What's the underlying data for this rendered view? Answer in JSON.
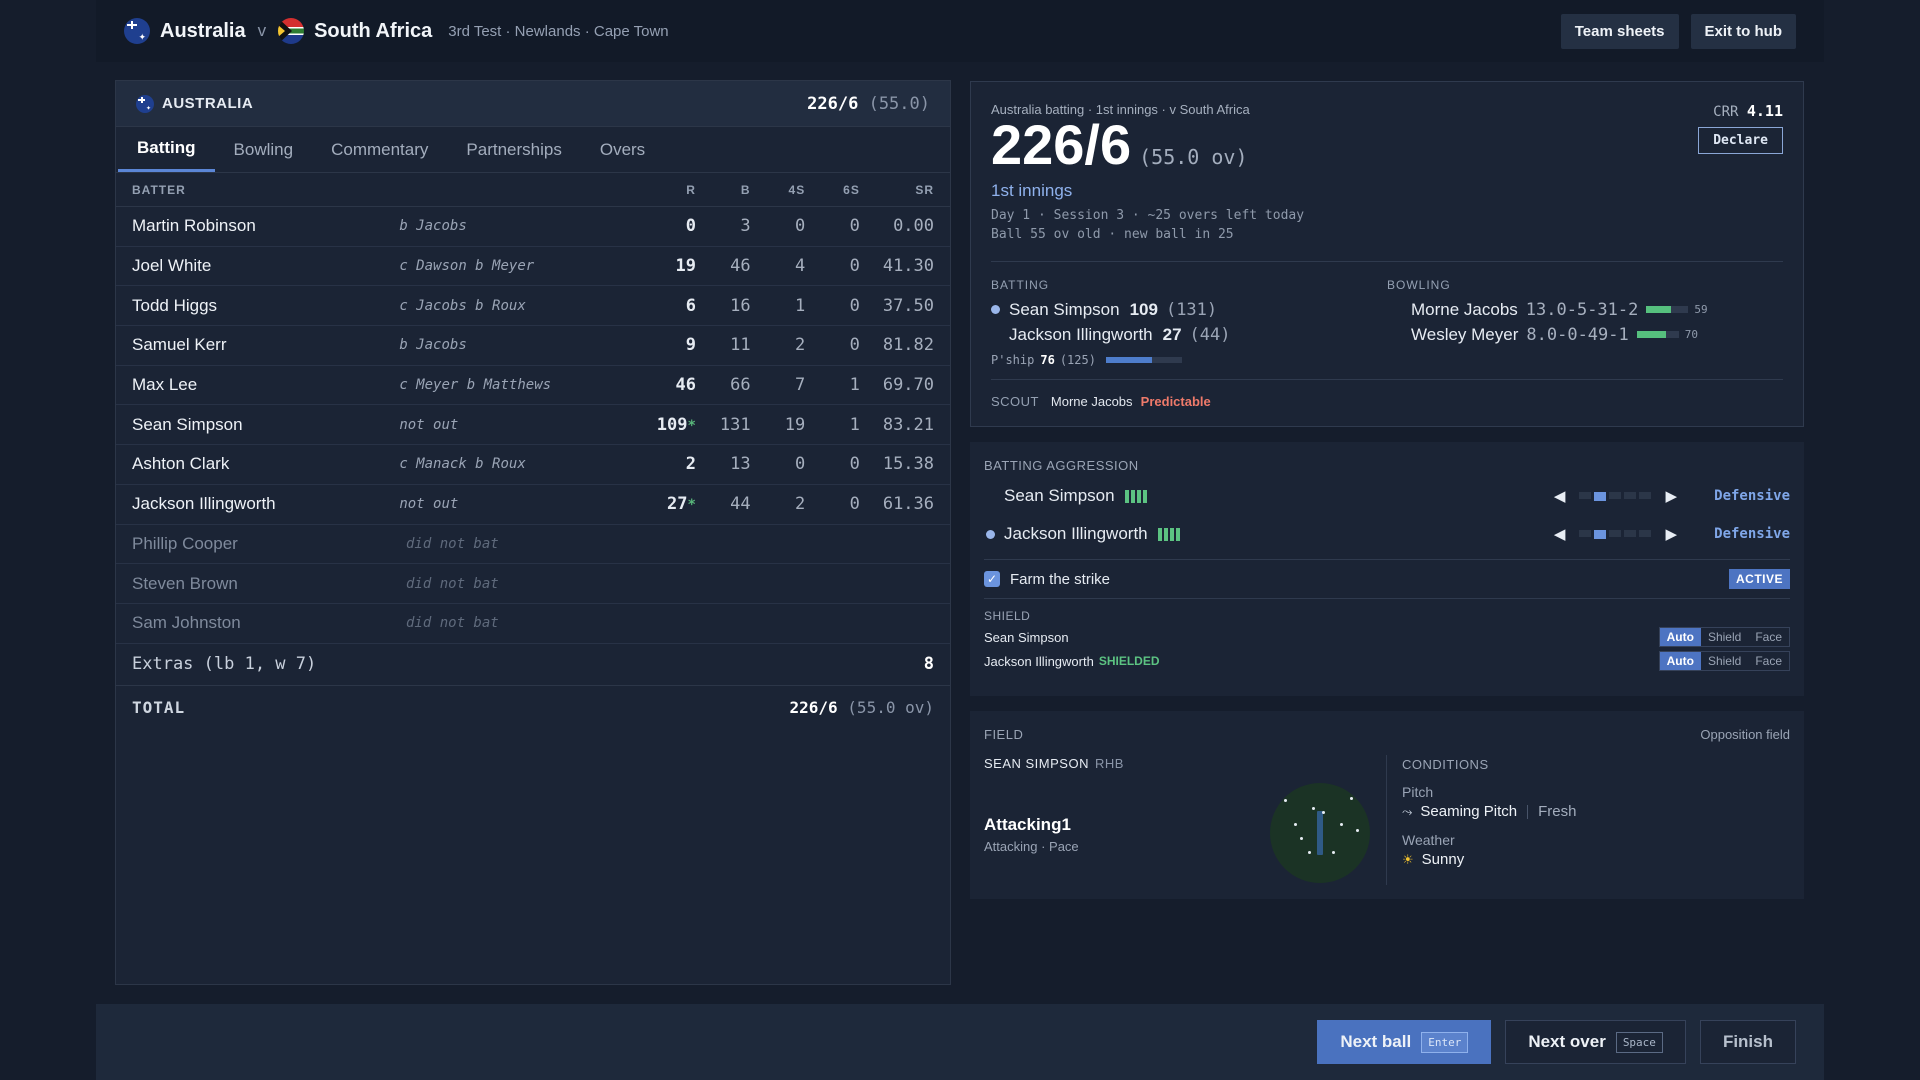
{
  "header": {
    "team1": "Australia",
    "vs": "v",
    "team2": "South Africa",
    "match_info": "3rd Test · Newlands · Cape Town",
    "buttons": {
      "team_sheets": "Team sheets",
      "exit": "Exit to hub"
    }
  },
  "scorecard": {
    "team": "AUSTRALIA",
    "score": "226/6",
    "overs": "(55.0)",
    "tabs": [
      "Batting",
      "Bowling",
      "Commentary",
      "Partnerships",
      "Overs"
    ],
    "columns": {
      "batter": "BATTER",
      "r": "R",
      "b": "B",
      "fours": "4S",
      "sixes": "6S",
      "sr": "SR"
    },
    "batters": [
      {
        "name": "Martin Robinson",
        "dismissal": "b Jacobs",
        "r": "0",
        "b": "3",
        "fours": "0",
        "sixes": "0",
        "sr": "0.00",
        "star": ""
      },
      {
        "name": "Joel White",
        "dismissal": "c Dawson b Meyer",
        "r": "19",
        "b": "46",
        "fours": "4",
        "sixes": "0",
        "sr": "41.30",
        "star": ""
      },
      {
        "name": "Todd Higgs",
        "dismissal": "c Jacobs b Roux",
        "r": "6",
        "b": "16",
        "fours": "1",
        "sixes": "0",
        "sr": "37.50",
        "star": ""
      },
      {
        "name": "Samuel Kerr",
        "dismissal": "b Jacobs",
        "r": "9",
        "b": "11",
        "fours": "2",
        "sixes": "0",
        "sr": "81.82",
        "star": ""
      },
      {
        "name": "Max Lee",
        "dismissal": "c Meyer b Matthews",
        "r": "46",
        "b": "66",
        "fours": "7",
        "sixes": "1",
        "sr": "69.70",
        "star": ""
      },
      {
        "name": "Sean Simpson",
        "dismissal": "not out",
        "r": "109",
        "b": "131",
        "fours": "19",
        "sixes": "1",
        "sr": "83.21",
        "star": "*"
      },
      {
        "name": "Ashton Clark",
        "dismissal": "c Manack b Roux",
        "r": "2",
        "b": "13",
        "fours": "0",
        "sixes": "0",
        "sr": "15.38",
        "star": ""
      },
      {
        "name": "Jackson Illingworth",
        "dismissal": "not out",
        "r": "27",
        "b": "44",
        "fours": "2",
        "sixes": "0",
        "sr": "61.36",
        "star": "*"
      }
    ],
    "dnb": [
      {
        "name": "Phillip Cooper",
        "dismissal": "did not bat"
      },
      {
        "name": "Steven Brown",
        "dismissal": "did not bat"
      },
      {
        "name": "Sam Johnston",
        "dismissal": "did not bat"
      }
    ],
    "extras_label": "Extras (lb 1, w 7)",
    "extras_value": "8",
    "total_label": "TOTAL",
    "total_score": "226/6",
    "total_overs": "(55.0 ov)"
  },
  "summary": {
    "context": "Australia batting · 1st innings · v South Africa",
    "score": "226/6",
    "overs": "(55.0 ov)",
    "innings": "1st innings",
    "meta1": "Day 1 · Session 3 · ~25 overs left today",
    "meta2": "Ball 55 ov old · new ball in 25",
    "crr_label": "CRR",
    "crr_value": "4.11",
    "declare": "Declare",
    "batting_title": "BATTING",
    "bowling_title": "BOWLING",
    "batters": [
      {
        "name": "Sean Simpson",
        "runs": "109",
        "balls": "(131)"
      },
      {
        "name": "Jackson Illingworth",
        "runs": "27",
        "balls": "(44)"
      }
    ],
    "bowlers": [
      {
        "name": "Morne Jacobs",
        "figures": "13.0-5-31-2",
        "stamina": "59",
        "fill": 0.59
      },
      {
        "name": "Wesley Meyer",
        "figures": "8.0-0-49-1",
        "stamina": "70",
        "fill": 0.7
      }
    ],
    "pship_label": "P'ship",
    "pship_runs": "76",
    "pship_balls": "(125)",
    "pship_fill": 0.61,
    "scout_label": "SCOUT",
    "scout_name": "Morne Jacobs",
    "scout_tag": "Predictable"
  },
  "aggression": {
    "title": "BATTING AGGRESSION",
    "rows": [
      {
        "name": "Sean Simpson",
        "mode": "Defensive",
        "level": 2
      },
      {
        "name": "Jackson Illingworth",
        "mode": "Defensive",
        "level": 2
      }
    ],
    "farm_label": "Farm the strike",
    "farm_status": "ACTIVE",
    "shield_title": "SHIELD",
    "shield_rows": [
      {
        "name": "Sean Simpson",
        "tag": ""
      },
      {
        "name": "Jackson Illingworth",
        "tag": "SHIELDED"
      }
    ],
    "shield_options": [
      "Auto",
      "Shield",
      "Face"
    ]
  },
  "field": {
    "title": "FIELD",
    "opposition": "Opposition field",
    "batter": "SEAN SIMPSON",
    "hand": "RHB",
    "setup_name": "Attacking1",
    "setup_desc": "Attacking · Pace",
    "conditions_title": "CONDITIONS",
    "pitch_label": "Pitch",
    "pitch_value": "Seaming Pitch",
    "pitch_state": "Fresh",
    "weather_label": "Weather",
    "weather_value": "Sunny"
  },
  "footer": {
    "next_ball": "Next ball",
    "next_ball_key": "Enter",
    "next_over": "Next over",
    "next_over_key": "Space",
    "finish": "Finish"
  }
}
